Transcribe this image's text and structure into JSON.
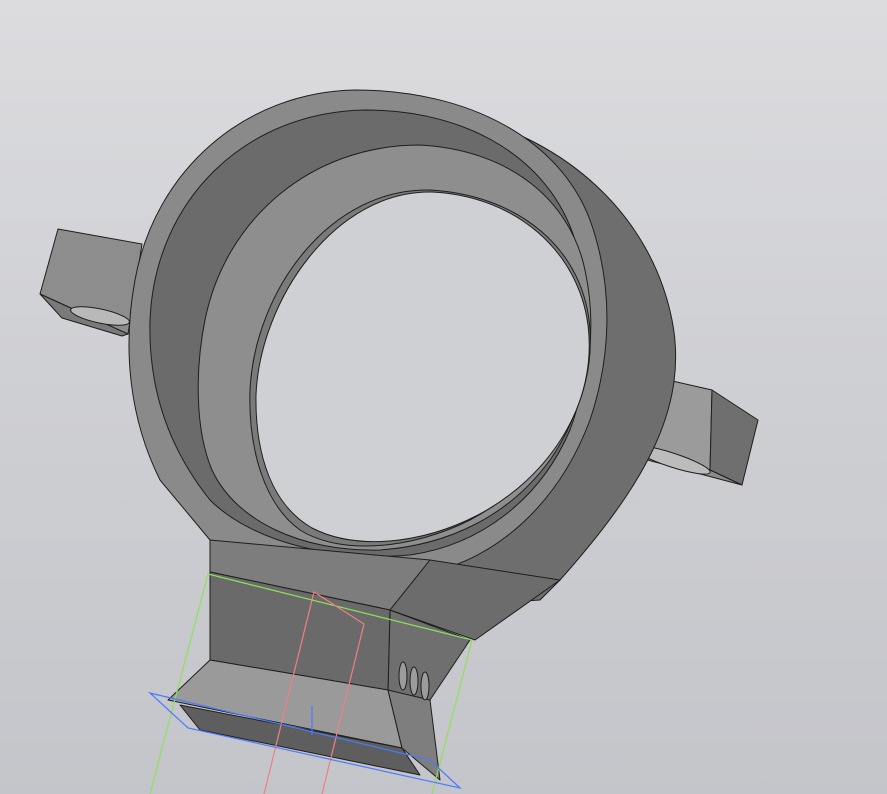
{
  "viewport": {
    "background": "#cfd0d4",
    "shading_colors": {
      "light": "#9a9a9a",
      "mid": "#8a8a8a",
      "dark": "#6b6b6b",
      "darker": "#5a5a5a"
    },
    "sketch_colors": {
      "green_sketch": "#8ee05a",
      "red_sketch": "#f08080",
      "blue_plane": "#4a7bff"
    }
  },
  "model": {
    "part": "ring-bracket",
    "features": [
      "outer-ring",
      "inner-ring",
      "bore",
      "left-lug",
      "right-lug",
      "neck-base",
      "vent-slots"
    ]
  }
}
